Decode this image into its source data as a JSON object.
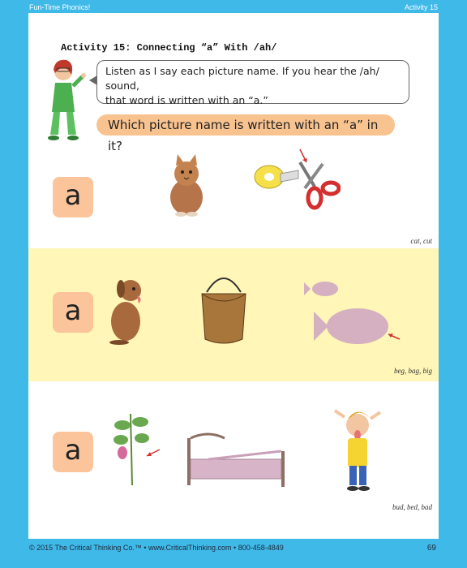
{
  "header": {
    "left": "Fun-Time Phonics!",
    "right": "Activity 15"
  },
  "title": "Activity 15:  Connecting “a” With /ah/",
  "instructions": {
    "line1": "Listen as I say each picture name.  If you hear the /ah/ sound,",
    "line2": "that word is written with an “a.”"
  },
  "question": "Which picture name is written with an “a” in it?",
  "rows": [
    {
      "letter": "a",
      "answer": "cat, cut"
    },
    {
      "letter": "a",
      "answer": "beg, bag, big"
    },
    {
      "letter": "a",
      "answer": "bud, bed, bad"
    }
  ],
  "footer": {
    "left": "© 2015 The Critical Thinking Co.™ • www.CriticalThinking.com • 800-458-4849",
    "page": "69"
  },
  "colors": {
    "border": "#3fb9e8",
    "letter_card": "#fbc49a",
    "highlight_row": "#fff6b8",
    "question_bg": "#f9c390"
  }
}
